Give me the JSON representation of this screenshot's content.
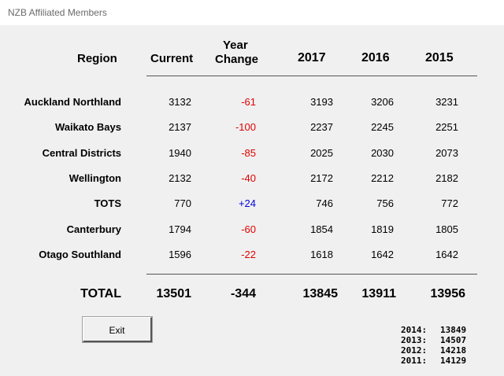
{
  "window": {
    "title": "NZB Affiliated Members"
  },
  "headers": {
    "region": "Region",
    "current": "Current",
    "year_change_line1": "Year",
    "year_change_line2": "Change",
    "y2017": "2017",
    "y2016": "2016",
    "y2015": "2015"
  },
  "rows": [
    {
      "region": "Auckland Northland",
      "current": "3132",
      "change": "-61",
      "y2017": "3193",
      "y2016": "3206",
      "y2015": "3231"
    },
    {
      "region": "Waikato Bays",
      "current": "2137",
      "change": "-100",
      "y2017": "2237",
      "y2016": "2245",
      "y2015": "2251"
    },
    {
      "region": "Central Districts",
      "current": "1940",
      "change": "-85",
      "y2017": "2025",
      "y2016": "2030",
      "y2015": "2073"
    },
    {
      "region": "Wellington",
      "current": "2132",
      "change": "-40",
      "y2017": "2172",
      "y2016": "2212",
      "y2015": "2182"
    },
    {
      "region": "TOTS",
      "current": "770",
      "change": "+24",
      "y2017": "746",
      "y2016": "756",
      "y2015": "772"
    },
    {
      "region": "Canterbury",
      "current": "1794",
      "change": "-60",
      "y2017": "1854",
      "y2016": "1819",
      "y2015": "1805"
    },
    {
      "region": "Otago Southland",
      "current": "1596",
      "change": "-22",
      "y2017": "1618",
      "y2016": "1642",
      "y2015": "1642"
    }
  ],
  "total": {
    "label": "TOTAL",
    "current": "13501",
    "change": "-344",
    "y2017": "13845",
    "y2016": "13911",
    "y2015": "13956"
  },
  "exit_label": "Exit",
  "history": [
    {
      "year": "2014:",
      "value": "13849"
    },
    {
      "year": "2013:",
      "value": "14507"
    },
    {
      "year": "2012:",
      "value": "14218"
    },
    {
      "year": "2011:",
      "value": "14129"
    }
  ],
  "colors": {
    "negative": "#e00000",
    "positive": "#0000e0"
  }
}
